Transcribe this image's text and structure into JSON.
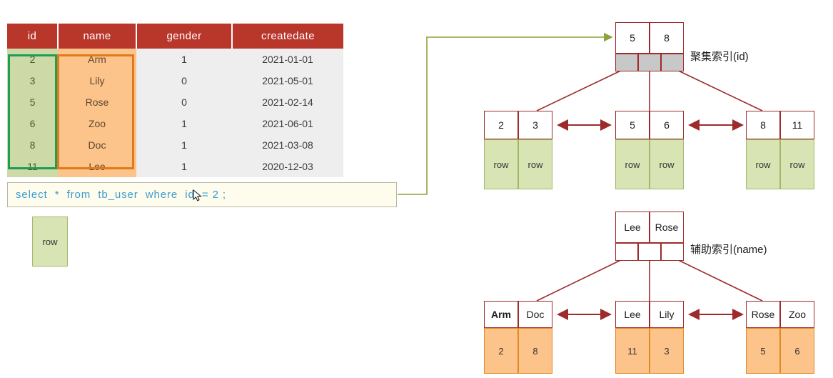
{
  "table": {
    "name": "tb_user",
    "columns": [
      "id",
      "name",
      "gender",
      "createdate"
    ],
    "rows": [
      {
        "id": "2",
        "name": "Arm",
        "gender": "1",
        "createdate": "2021-01-01"
      },
      {
        "id": "3",
        "name": "Lily",
        "gender": "0",
        "createdate": "2021-05-01"
      },
      {
        "id": "5",
        "name": "Rose",
        "gender": "0",
        "createdate": "2021-02-14"
      },
      {
        "id": "6",
        "name": "Zoo",
        "gender": "1",
        "createdate": "2021-06-01"
      },
      {
        "id": "8",
        "name": "Doc",
        "gender": "1",
        "createdate": "2021-03-08"
      },
      {
        "id": "11",
        "name": "Lee",
        "gender": "1",
        "createdate": "2020-12-03"
      }
    ],
    "highlight": {
      "id_column_color": "#1f9d55",
      "name_column_color": "#e07a1b",
      "header_color": "#b9362b",
      "id_cell_color": "#cddaa8",
      "name_cell_color": "#fcc38a"
    }
  },
  "sql": {
    "query": "select  *  from  tb_user  where  id  = 2 ;",
    "text_color": "#3c9bd0",
    "background_color": "#fdfced"
  },
  "result": {
    "row_label": "row"
  },
  "clustered_index": {
    "label": "聚集索引(id)",
    "root": {
      "keys": [
        "5",
        "8"
      ],
      "pointers": [
        "",
        "",
        ""
      ]
    },
    "leaves": [
      {
        "keys": [
          "2",
          "3"
        ],
        "values": [
          "row",
          "row"
        ]
      },
      {
        "keys": [
          "5",
          "6"
        ],
        "values": [
          "row",
          "row"
        ]
      },
      {
        "keys": [
          "8",
          "11"
        ],
        "values": [
          "row",
          "row"
        ]
      }
    ],
    "value_cell_color": "#d9e4b4",
    "pointer_cell_color": "#c8c8c8",
    "border_color": "#9d2b2b"
  },
  "secondary_index": {
    "label": "辅助索引(name)",
    "root": {
      "keys": [
        "Lee",
        "Rose"
      ],
      "pointers": [
        "",
        "",
        ""
      ]
    },
    "leaves": [
      {
        "keys": [
          "Arm",
          "Doc"
        ],
        "values": [
          "2",
          "8"
        ],
        "bold": [
          true,
          false
        ]
      },
      {
        "keys": [
          "Lee",
          "Lily"
        ],
        "values": [
          "11",
          "3"
        ],
        "bold": [
          false,
          false
        ]
      },
      {
        "keys": [
          "Rose",
          "Zoo"
        ],
        "values": [
          "5",
          "6"
        ],
        "bold": [
          false,
          false
        ]
      }
    ],
    "value_cell_color": "#fcc38a",
    "border_color": "#9d2b2b"
  },
  "connectors": {
    "query_arrow_color": "#8aa33c",
    "tree_link_color": "#9d2b2b"
  }
}
